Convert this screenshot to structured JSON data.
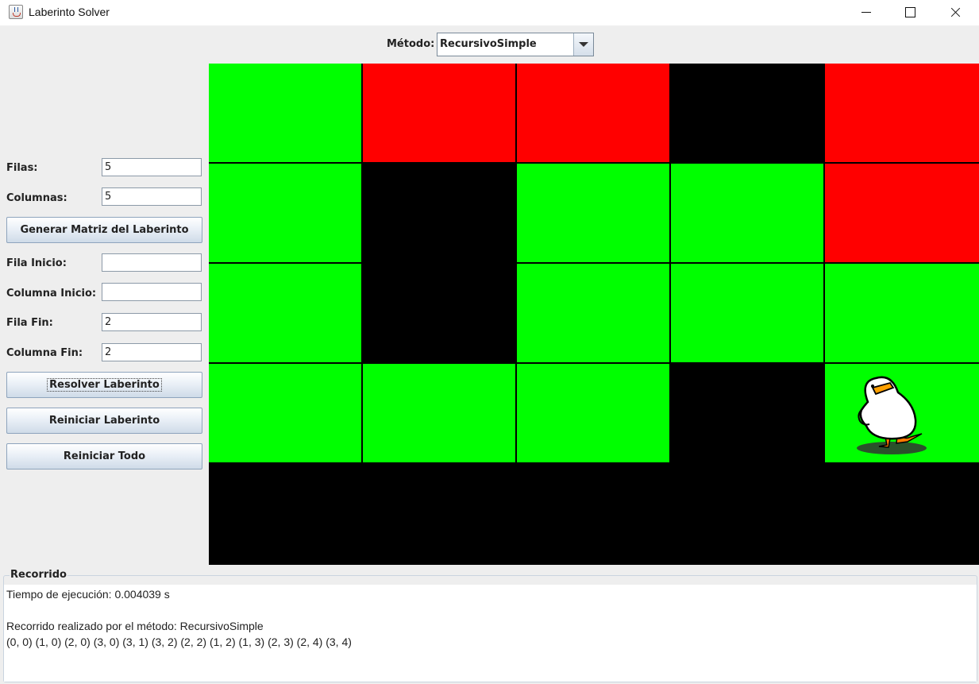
{
  "window": {
    "title": "Laberinto Solver",
    "icon": "java-cup-icon"
  },
  "method": {
    "label": "Método:",
    "selected": "RecursivoSimple"
  },
  "form": {
    "filas_label": "Filas:",
    "filas_value": "5",
    "columnas_label": "Columnas:",
    "columnas_value": "5",
    "generar_label": "Generar Matriz del Laberinto",
    "fila_inicio_label": "Fila Inicio:",
    "fila_inicio_value": "",
    "columna_inicio_label": "Columna Inicio:",
    "columna_inicio_value": "",
    "fila_fin_label": "Fila Fin:",
    "fila_fin_value": "2",
    "columna_fin_label": "Columna Fin:",
    "columna_fin_value": "2",
    "resolver_label": "Resolver Laberinto",
    "reiniciar_lab_label": "Reiniciar Laberinto",
    "reiniciar_todo_label": "Reiniciar Todo"
  },
  "maze": {
    "rows": 5,
    "cols": 5,
    "colors": {
      "open": "#00ff00",
      "visited": "#ff0000",
      "wall": "#000000"
    },
    "grid": [
      [
        "open",
        "visited",
        "visited",
        "wall",
        "visited"
      ],
      [
        "open",
        "wall",
        "open",
        "open",
        "visited"
      ],
      [
        "open",
        "wall",
        "open",
        "open",
        "open"
      ],
      [
        "open",
        "open",
        "open",
        "wall",
        "open"
      ],
      [
        "wall",
        "wall",
        "wall",
        "wall",
        "wall"
      ]
    ],
    "duck_cell": [
      3,
      4
    ]
  },
  "recorrido": {
    "title": "Recorrido",
    "lines": [
      "Tiempo de ejecución: 0.004039 s",
      "",
      "Recorrido realizado por el método: RecursivoSimple",
      "(0, 0) (1, 0) (2, 0) (3, 0) (3, 1) (3, 2) (2, 2) (1, 2) (1, 3) (2, 3) (2, 4) (3, 4)"
    ]
  }
}
